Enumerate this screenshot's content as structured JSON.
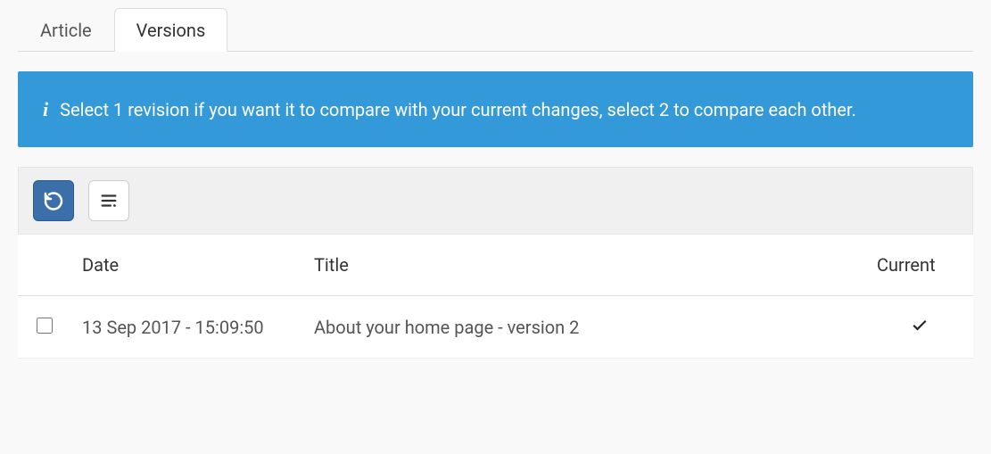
{
  "tabs": [
    {
      "label": "Article",
      "active": false
    },
    {
      "label": "Versions",
      "active": true
    }
  ],
  "info": {
    "message": "Select 1 revision if you want it to compare with your current changes, select 2 to compare each other."
  },
  "toolbar": {
    "revert_tooltip": "Revert",
    "compare_tooltip": "Compare"
  },
  "table": {
    "headers": {
      "date": "Date",
      "title": "Title",
      "current": "Current"
    },
    "rows": [
      {
        "date": "13 Sep 2017 - 15:09:50",
        "title": "About your home page - version 2",
        "current": true
      }
    ]
  }
}
